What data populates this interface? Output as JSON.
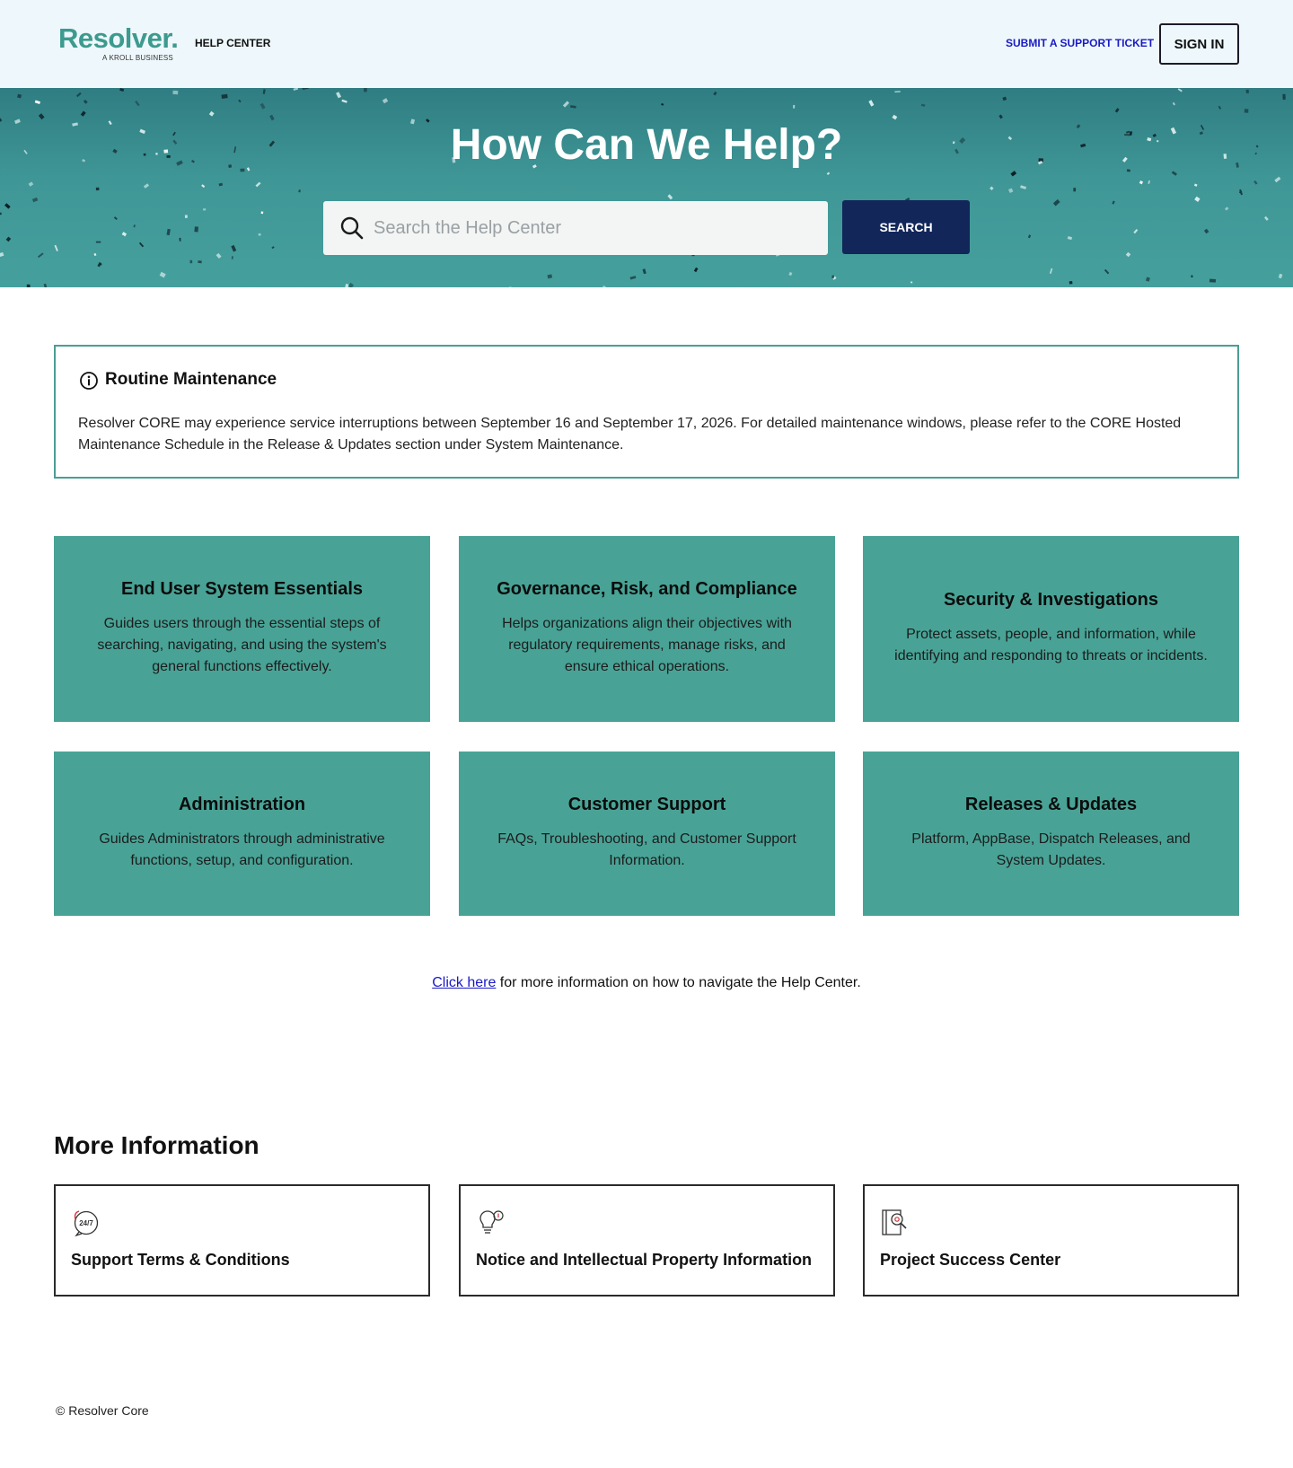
{
  "header": {
    "logo_text": "Resolver.",
    "logo_subtext": "A KROLL BUSINESS",
    "help_center_label": "HELP CENTER",
    "submit_ticket_label": "SUBMIT A SUPPORT TICKET",
    "sign_in_label": "SIGN IN"
  },
  "hero": {
    "title": "How Can We Help?",
    "search_placeholder": "Search the Help Center",
    "search_button_label": "SEARCH"
  },
  "notice": {
    "icon": "info-circle-icon",
    "title": "Routine Maintenance",
    "body": "Resolver CORE may experience service interruptions between September 16 and September 17, 2026. For detailed maintenance windows, please refer to the CORE Hosted Maintenance Schedule in the Release & Updates section under System Maintenance."
  },
  "categories": [
    {
      "title": "End User System Essentials",
      "description": "Guides users through the essential steps of searching, navigating, and using the system's general functions effectively."
    },
    {
      "title": "Governance, Risk, and Compliance",
      "description": "Helps organizations align their objectives with regulatory requirements, manage risks, and ensure ethical operations."
    },
    {
      "title": "Security & Investigations",
      "description": "Protect assets, people, and information, while identifying and responding to threats or incidents."
    },
    {
      "title": "Administration",
      "description": "Guides Administrators through administrative functions, setup, and configuration."
    },
    {
      "title": "Customer Support",
      "description": "FAQs, Troubleshooting, and Customer Support Information."
    },
    {
      "title": "Releases & Updates",
      "description": "Platform, AppBase, Dispatch Releases, and System Updates."
    }
  ],
  "nav_help": {
    "link_text": "Click here",
    "rest_text": " for more information on how to navigate the Help Center."
  },
  "more_info": {
    "title": "More Information",
    "items": [
      {
        "label": "Support Terms & Conditions",
        "icon": "support-24-7-icon",
        "icon_text": "24/7"
      },
      {
        "label": "Notice and Intellectual Property Information",
        "icon": "lightbulb-icon"
      },
      {
        "label": "Project Success Center",
        "icon": "book-icon"
      }
    ]
  },
  "footer": {
    "copyright": "© Resolver Core"
  },
  "colors": {
    "brand_teal": "#3d9a8e",
    "card_teal": "#48a396",
    "search_button": "#12265a",
    "link_blue": "#1a1ac4",
    "header_bg": "#eef8fc"
  }
}
